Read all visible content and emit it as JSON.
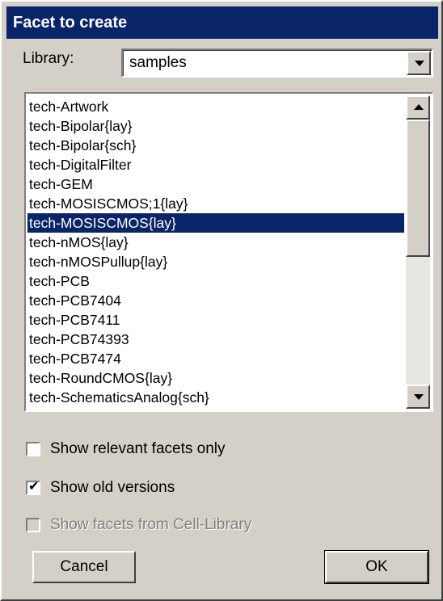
{
  "dialog": {
    "title": "Facet to create"
  },
  "library": {
    "label": "Library:",
    "selected": "samples"
  },
  "facet_list": {
    "items": [
      "tech-Artwork",
      "tech-Bipolar{lay}",
      "tech-Bipolar{sch}",
      "tech-DigitalFilter",
      "tech-GEM",
      "tech-MOSISCMOS;1{lay}",
      "tech-MOSISCMOS{lay}",
      "tech-nMOS{lay}",
      "tech-nMOSPullup{lay}",
      "tech-PCB",
      "tech-PCB7404",
      "tech-PCB7411",
      "tech-PCB74393",
      "tech-PCB7474",
      "tech-RoundCMOS{lay}",
      "tech-SchematicsAnalog{sch}"
    ],
    "selected": "tech-MOSISCMOS{lay}"
  },
  "options": {
    "relevant_only": {
      "label": "Show relevant facets only",
      "checked": false
    },
    "old_versions": {
      "label": "Show old versions",
      "checked": true
    },
    "cell_library": {
      "label": "Show facets from Cell-Library",
      "checked": false,
      "disabled": true
    }
  },
  "buttons": {
    "cancel": "Cancel",
    "ok": "OK"
  },
  "colors": {
    "selection": "#0a246a",
    "face": "#d4d0c8"
  }
}
